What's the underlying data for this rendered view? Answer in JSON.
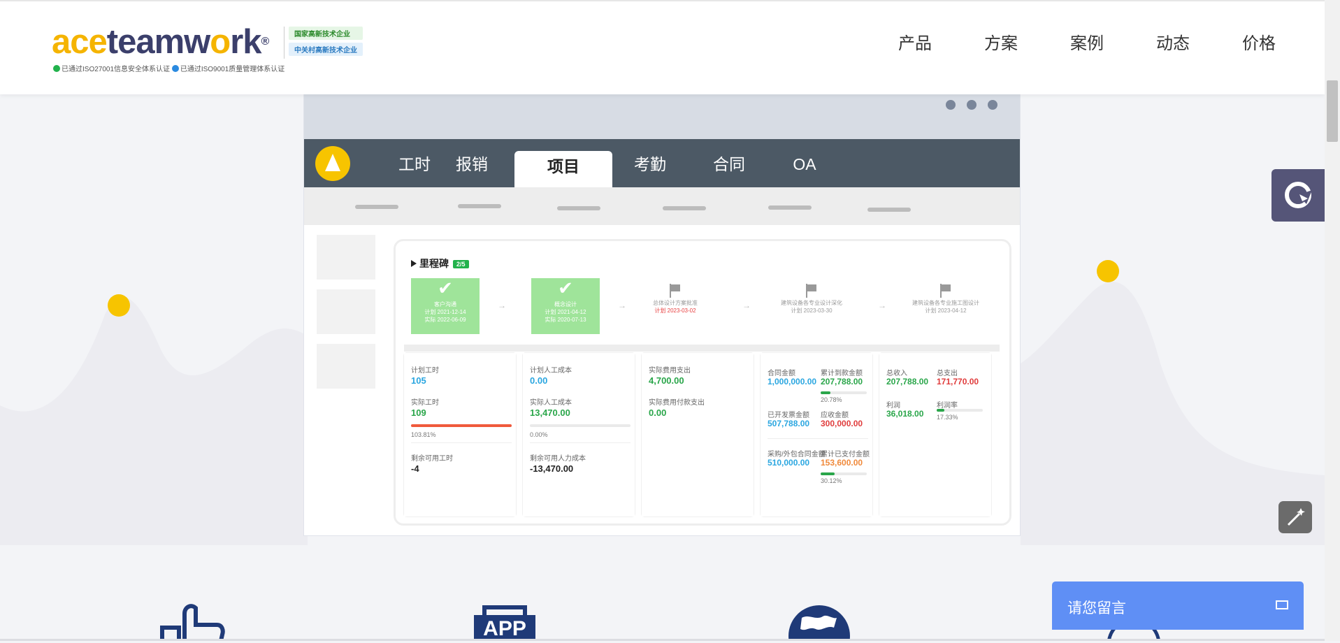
{
  "header": {
    "logo": {
      "ace": "ace",
      "team": "teamw",
      "ork_o": "o",
      "rk": "rk",
      "reg": "®"
    },
    "badges": [
      "国家高新技术企业",
      "中关村高新技术企业"
    ],
    "certs": [
      "已通过ISO27001信息安全体系认证",
      "已通过ISO9001质量管理体系认证"
    ],
    "nav": [
      "产品",
      "方案",
      "案例",
      "动态",
      "价格"
    ]
  },
  "mockup": {
    "tabs": [
      "工时",
      "报销",
      "项目",
      "考勤",
      "合同",
      "OA"
    ],
    "active_tab": "项目",
    "milestones": {
      "title": "里程碑",
      "count": "2/5",
      "items": [
        {
          "name": "客户沟通",
          "plan": "计划 2021-12-14",
          "actual": "实际 2022-06-09",
          "status": "done"
        },
        {
          "name": "概念设计",
          "plan": "计划 2021-04-12",
          "actual": "实际 2020-07-13",
          "status": "done"
        },
        {
          "name": "总体设计方案批准",
          "plan": "计划 2023-03-02",
          "status": "overdue"
        },
        {
          "name": "建筑设备各专业设计深化",
          "plan": "计划 2023-03-30",
          "status": "todo"
        },
        {
          "name": "建筑设备各专业施工图设计",
          "plan": "计划 2023-04-12",
          "status": "todo"
        }
      ]
    },
    "hours": {
      "planned_label": "计划工时",
      "planned": "105",
      "actual_label": "实际工时",
      "actual": "109",
      "pct": "103.81%",
      "pct_value": 103.81,
      "remaining_label": "剩余可用工时",
      "remaining": "-4"
    },
    "labor": {
      "planned_label": "计划人工成本",
      "planned": "0.00",
      "actual_label": "实际人工成本",
      "actual": "13,470.00",
      "pct": "0.00%",
      "pct_value": 0,
      "remaining_label": "剩余可用人力成本",
      "remaining": "-13,470.00"
    },
    "expense": {
      "actual_label": "实际费用支出",
      "actual": "4,700.00",
      "paid_label": "实际费用付款支出",
      "paid": "0.00"
    },
    "contract": {
      "amount_label": "合同金额",
      "amount": "1,000,000.00",
      "received_label": "累计到款金额",
      "received": "207,788.00",
      "received_pct": "20.78%",
      "received_pct_value": 20.78,
      "invoiced_label": "已开发票金额",
      "invoiced": "507,788.00",
      "receivable_label": "应收金额",
      "receivable": "300,000.00",
      "purchase_label": "采购/外包合同金额",
      "purchase": "510,000.00",
      "paid_label": "累计已支付金额",
      "paid": "153,600.00",
      "paid_pct": "30.12%",
      "paid_pct_value": 30.12
    },
    "profit": {
      "income_label": "总收入",
      "income": "207,788.00",
      "spend_label": "总支出",
      "spend": "171,770.00",
      "profit_label": "利润",
      "profit": "36,018.00",
      "rate_label": "利润率",
      "rate": "17.33%",
      "rate_value": 17.33
    }
  },
  "features": {
    "app_label": "APP"
  },
  "chat": {
    "label": "请您留言"
  },
  "colors": {
    "accent_yellow": "#f7c400",
    "brand_navy": "#3b3f6b",
    "mock_tabbar": "#4c5965",
    "chat_blue": "#5f8ff5",
    "service_purple": "#555578"
  }
}
